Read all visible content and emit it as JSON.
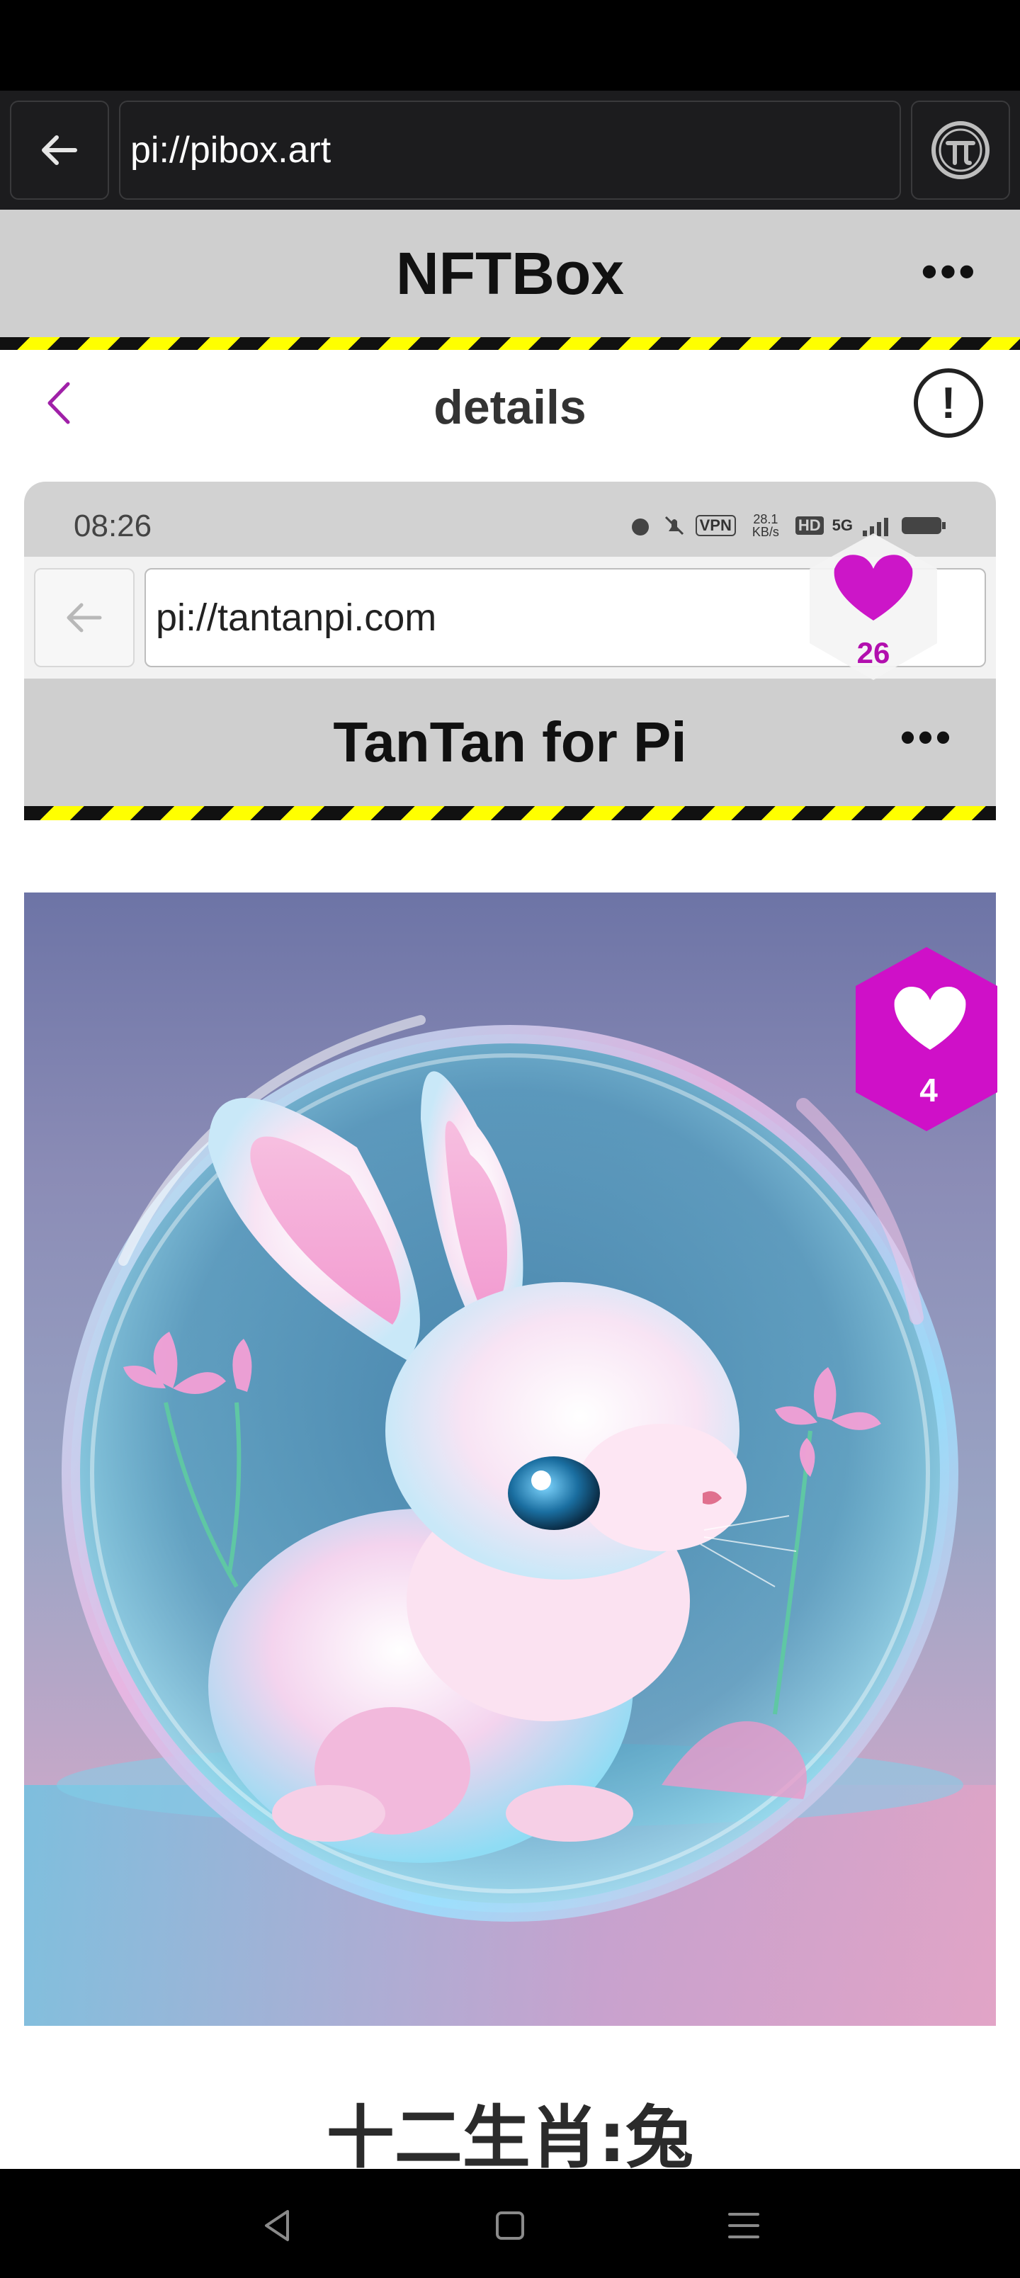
{
  "browser": {
    "url": "pi://pibox.art",
    "back_icon": "arrow-left-icon",
    "pi_icon": "pi-logo-icon"
  },
  "app_header": {
    "title": "NFTBox",
    "more": "•••"
  },
  "details_bar": {
    "title": "details",
    "info": "!"
  },
  "embedded_screenshot": {
    "status_time": "08:26",
    "status_icons": [
      "VPN",
      "28.1 KB/s",
      "HD",
      "5G"
    ],
    "url": "pi://tantanpi.com",
    "title": "TanTan for Pi",
    "more": "•••",
    "inner_like_count": "4"
  },
  "like_badge": {
    "count": "26"
  },
  "nft": {
    "name": "十二生肖:兔"
  },
  "colors": {
    "accent": "#c21bc8",
    "stripe_yellow": "#ffff00",
    "header_gray": "#cfcfcf"
  }
}
